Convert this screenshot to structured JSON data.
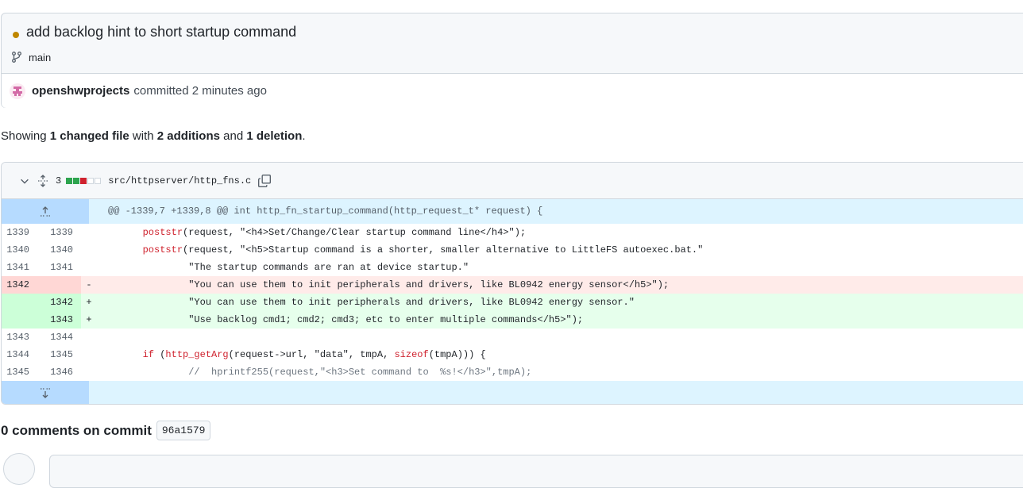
{
  "commit": {
    "title": "add backlog hint to short startup command",
    "status_color": "#bf8700",
    "branch": "main",
    "author": "openshwprojects",
    "meta": "committed 2 minutes ago"
  },
  "summary": {
    "showing": "Showing",
    "changed": "1 changed file",
    "with": "with",
    "additions": "2 additions",
    "and": "and",
    "deletions": "1 deletion",
    "end": "."
  },
  "file": {
    "diffstat_count": "3",
    "diffstat_blocks": [
      "add",
      "add",
      "del",
      "neutral",
      "neutral"
    ],
    "path": "src/httpserver/http_fns.c",
    "hunk_header": "@@ -1339,7 +1339,8 @@ int http_fn_startup_command(http_request_t* request) {",
    "lines": [
      {
        "type": "ctx",
        "old": "1339",
        "new": "1339",
        "mark": "",
        "segments": [
          {
            "t": "        "
          },
          {
            "t": "poststr",
            "c": "kw"
          },
          {
            "t": "(request, \""
          },
          {
            "t": "<h4>Set/Change/Clear startup command line</h4>"
          },
          {
            "t": "\");"
          }
        ]
      },
      {
        "type": "ctx",
        "old": "1340",
        "new": "1340",
        "mark": "",
        "segments": [
          {
            "t": "        "
          },
          {
            "t": "poststr",
            "c": "kw"
          },
          {
            "t": "(request, \"<h5>Startup command is a shorter, smaller alternative to LittleFS autoexec.bat.\""
          }
        ]
      },
      {
        "type": "ctx",
        "old": "1341",
        "new": "1341",
        "mark": "",
        "segments": [
          {
            "t": "                \"The startup commands are ran at device startup.\""
          }
        ]
      },
      {
        "type": "del",
        "old": "1342",
        "new": "",
        "mark": "-",
        "segments": [
          {
            "t": "                \"You can use them to init peripherals and drivers, like BL0942 energy sensor</h5>\");"
          }
        ]
      },
      {
        "type": "add",
        "old": "",
        "new": "1342",
        "mark": "+",
        "segments": [
          {
            "t": "                \"You can use them to init peripherals and drivers, like BL0942 energy sensor.\""
          }
        ]
      },
      {
        "type": "add",
        "old": "",
        "new": "1343",
        "mark": "+",
        "segments": [
          {
            "t": "                \"Use backlog cmd1; cmd2; cmd3; etc to enter multiple commands</h5>\");"
          }
        ]
      },
      {
        "type": "ctx",
        "old": "1343",
        "new": "1344",
        "mark": "",
        "segments": [
          {
            "t": ""
          }
        ]
      },
      {
        "type": "ctx",
        "old": "1344",
        "new": "1345",
        "mark": "",
        "segments": [
          {
            "t": "        "
          },
          {
            "t": "if",
            "c": "kw"
          },
          {
            "t": " ("
          },
          {
            "t": "http_getArg",
            "c": "kw"
          },
          {
            "t": "(request->url, \"data\", tmpA, "
          },
          {
            "t": "sizeof",
            "c": "kw"
          },
          {
            "t": "(tmpA))) {"
          }
        ]
      },
      {
        "type": "ctx",
        "old": "1345",
        "new": "1346",
        "mark": "",
        "segments": [
          {
            "t": "                "
          },
          {
            "t": "//  hprintf255(request,\"<h3>Set command to  %s!</h3>\",tmpA);",
            "c": "cmt"
          }
        ]
      }
    ]
  },
  "comments": {
    "heading": "0 comments on commit",
    "sha": "96a1579"
  }
}
